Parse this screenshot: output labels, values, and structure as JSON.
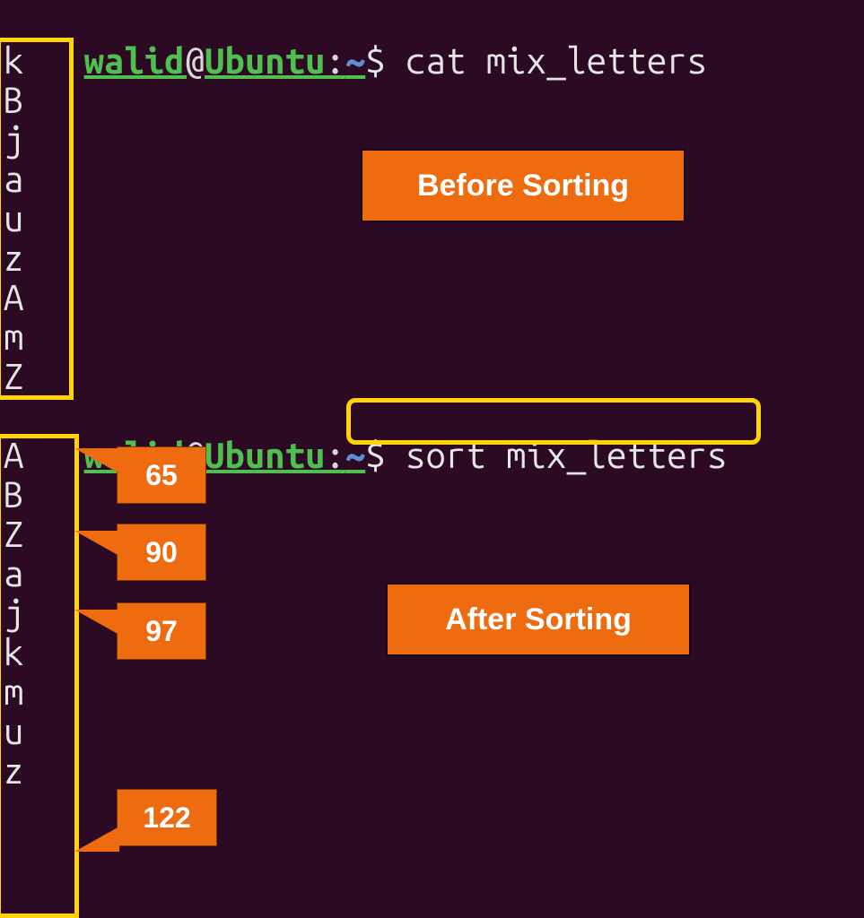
{
  "prompt1": {
    "user": "walid",
    "at": "@",
    "host": "Ubuntu",
    "colon": ":",
    "path": "~",
    "dollar": "$ ",
    "command": "cat mix_letters"
  },
  "unsorted": [
    "k",
    "B",
    "j",
    "a",
    "u",
    "z",
    "A",
    "m",
    "Z"
  ],
  "prompt2": {
    "user": "walid",
    "at": "@",
    "host": "Ubuntu",
    "colon": ":",
    "path": "~",
    "dollar": "$ ",
    "command": "sort mix_letters"
  },
  "sorted": [
    "A",
    "B",
    "Z",
    "a",
    "j",
    "k",
    "m",
    "u",
    "z"
  ],
  "labels": {
    "before": "Before Sorting",
    "after": "After Sorting"
  },
  "ascii": {
    "A": "65",
    "Z": "90",
    "a": "97",
    "z": "122"
  }
}
